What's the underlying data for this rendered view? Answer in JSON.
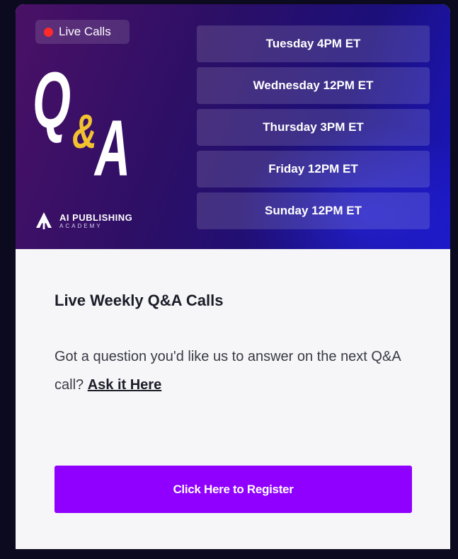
{
  "banner": {
    "badge_label": "Live Calls",
    "logo": {
      "q": "Q",
      "amp": "&",
      "a": "A"
    },
    "brand_name": "AI PUBLISHING",
    "brand_sub": "ACADEMY",
    "schedule": [
      "Tuesday 4PM ET",
      "Wednesday 12PM ET",
      "Thursday 3PM ET",
      "Friday 12PM ET",
      "Sunday 12PM ET"
    ]
  },
  "content": {
    "title": "Live Weekly Q&A Calls",
    "description": "Got a question you'd like us to answer on the next Q&A call?",
    "link_label": "Ask it Here",
    "register_label": "Click Here to Register"
  },
  "colors": {
    "accent": "#8f00ff",
    "live_dot": "#ff2a2a",
    "amp_gold": "#f2c230"
  },
  "icons": {
    "live": "live-dot-icon",
    "brand": "ai-publishing-logo-icon"
  }
}
